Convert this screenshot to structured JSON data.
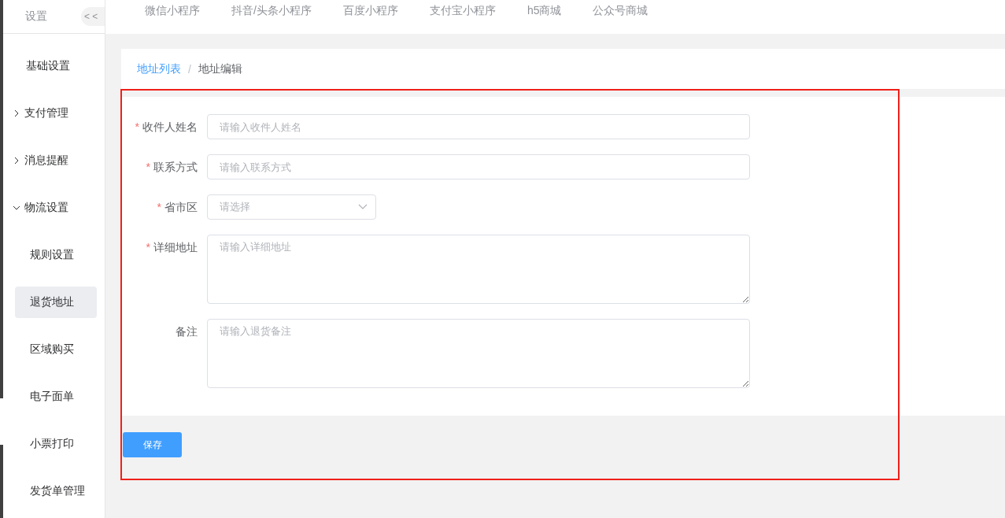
{
  "sidebar": {
    "title": "设置",
    "collapse_button": "< <",
    "items": [
      {
        "label": "基础设置",
        "kind": "item",
        "selected": false
      },
      {
        "label": "支付管理",
        "kind": "group",
        "expanded": false,
        "selected": false
      },
      {
        "label": "消息提醒",
        "kind": "group",
        "expanded": false,
        "selected": false
      },
      {
        "label": "物流设置",
        "kind": "group",
        "expanded": true,
        "selected": false,
        "children": [
          {
            "label": "规则设置",
            "selected": false
          },
          {
            "label": "退货地址",
            "selected": true
          },
          {
            "label": "区域购买",
            "selected": false
          },
          {
            "label": "电子面单",
            "selected": false
          },
          {
            "label": "小票打印",
            "selected": false
          },
          {
            "label": "发货单管理",
            "selected": false
          }
        ]
      }
    ]
  },
  "top_tabs": [
    {
      "label": "微信小程序",
      "selected": false
    },
    {
      "label": "抖音/头条小程序",
      "selected": false
    },
    {
      "label": "百度小程序",
      "selected": false
    },
    {
      "label": "支付宝小程序",
      "selected": false
    },
    {
      "label": "h5商城",
      "selected": false
    },
    {
      "label": "公众号商城",
      "selected": false
    }
  ],
  "breadcrumb": {
    "separator": "/",
    "items": [
      {
        "label": "地址列表",
        "link": true
      },
      {
        "label": "地址编辑",
        "link": false
      }
    ]
  },
  "form": {
    "fields": [
      {
        "label": "收件人姓名",
        "required": true,
        "kind": "input",
        "placeholder": "请输入收件人姓名"
      },
      {
        "label": "联系方式",
        "required": true,
        "kind": "input",
        "placeholder": "请输入联系方式"
      },
      {
        "label": "省市区",
        "required": true,
        "kind": "select",
        "placeholder": "请选择"
      },
      {
        "label": "详细地址",
        "required": true,
        "kind": "textarea",
        "placeholder": "请输入详细地址"
      },
      {
        "label": "备注",
        "required": false,
        "kind": "textarea",
        "placeholder": "请输入退货备注"
      }
    ],
    "required_mark": "*",
    "save_button": "保存"
  }
}
